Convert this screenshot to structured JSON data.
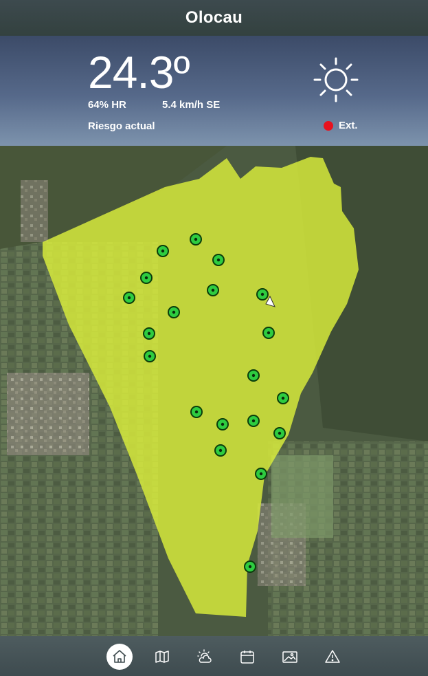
{
  "header": {
    "title": "Olocau"
  },
  "weather": {
    "temperature": "24.3º",
    "humidity": "64% HR",
    "wind": "5.4 km/h SE",
    "risk_label": "Riesgo actual",
    "risk_value": "Ext.",
    "risk_color": "#e8121e",
    "condition_icon": "sun-icon"
  },
  "map": {
    "zone_color": "#dcef3c",
    "marker_color": "#2ecc40",
    "markers": [
      {
        "id": "m1"
      },
      {
        "id": "m2"
      },
      {
        "id": "m3"
      },
      {
        "id": "m4"
      },
      {
        "id": "m5"
      },
      {
        "id": "m6"
      },
      {
        "id": "m7"
      },
      {
        "id": "m8"
      },
      {
        "id": "m9"
      },
      {
        "id": "m10"
      },
      {
        "id": "m11"
      },
      {
        "id": "m12"
      },
      {
        "id": "m13"
      },
      {
        "id": "m14"
      },
      {
        "id": "m15"
      },
      {
        "id": "m16"
      },
      {
        "id": "m17"
      },
      {
        "id": "m18"
      },
      {
        "id": "m19"
      },
      {
        "id": "m20"
      },
      {
        "id": "m21"
      }
    ],
    "location_icon": "location-arrow-icon"
  },
  "nav": {
    "items": [
      {
        "icon": "home-icon",
        "active": true
      },
      {
        "icon": "map-icon",
        "active": false
      },
      {
        "icon": "weather-icon",
        "active": false
      },
      {
        "icon": "calendar-icon",
        "active": false
      },
      {
        "icon": "gallery-icon",
        "active": false
      },
      {
        "icon": "warning-icon",
        "active": false
      }
    ]
  }
}
